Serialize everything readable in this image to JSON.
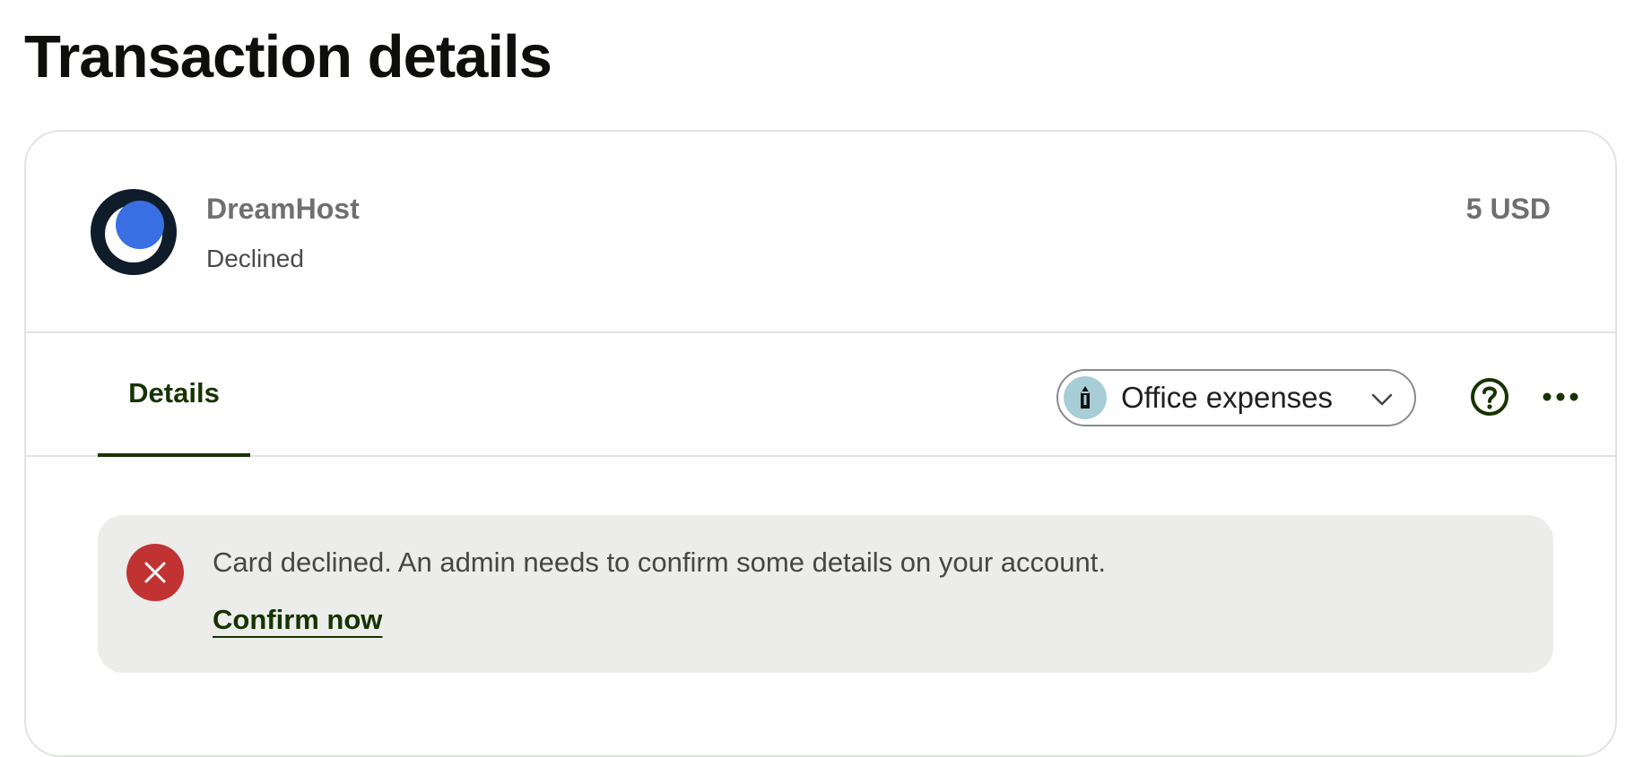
{
  "page": {
    "title": "Transaction details"
  },
  "merchant": {
    "name": "DreamHost",
    "status": "Declined",
    "amount": "5 USD",
    "logo_icon": "dreamhost-moon-logo",
    "logo_colors": {
      "ring": "#0f1c2a",
      "moon": "#ffffff",
      "sky": "#3a6fe3"
    }
  },
  "tabs": [
    {
      "label": "Details",
      "active": true
    }
  ],
  "category": {
    "selected": "Office expenses",
    "icon": "pencil-icon",
    "icon_bg": "#a7cdd6"
  },
  "actions": {
    "help_icon": "help-circle-icon",
    "more_icon": "more-horizontal-icon"
  },
  "alert": {
    "icon": "close-icon",
    "message": "Card declined. An admin needs to confirm some details on your account.",
    "link_label": "Confirm now",
    "color": "#c13333"
  },
  "colors": {
    "accent": "#163300",
    "alert_bg": "#ecedea",
    "border": "#e2e4e1"
  }
}
